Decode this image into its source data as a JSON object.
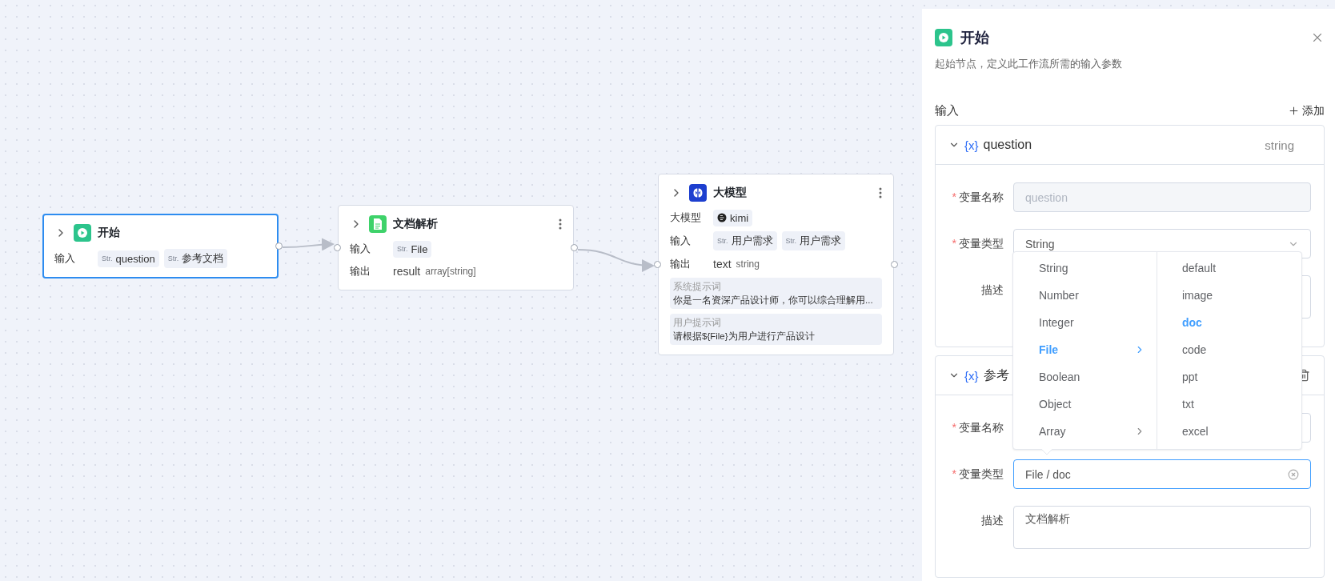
{
  "canvas": {
    "nodes": [
      {
        "kind": "start",
        "title": "开始",
        "selected": true,
        "rows": [
          {
            "kind": "chips",
            "label": "输入",
            "chips": [
              {
                "prefix": "Str.",
                "text": "question"
              },
              {
                "prefix": "Str.",
                "text": "参考文档"
              }
            ]
          }
        ]
      },
      {
        "kind": "doc",
        "title": "文档解析",
        "selected": false,
        "rows": [
          {
            "kind": "chips",
            "label": "输入",
            "chips": [
              {
                "prefix": "Str.",
                "text": "File"
              }
            ]
          },
          {
            "kind": "output",
            "label": "输出",
            "name": "result",
            "type": "array[string]"
          }
        ]
      },
      {
        "kind": "llm",
        "title": "大模型",
        "selected": false,
        "rows": [
          {
            "kind": "model",
            "label": "大模型",
            "model": "kimi"
          },
          {
            "kind": "chips",
            "label": "输入",
            "chips": [
              {
                "prefix": "Str.",
                "text": "用户需求"
              },
              {
                "prefix": "Str.",
                "text": "用户需求"
              }
            ]
          },
          {
            "kind": "output",
            "label": "输出",
            "name": "text",
            "type": "string"
          }
        ],
        "prompts": [
          {
            "label": "系统提示词",
            "text": "你是一名资深产品设计师，你可以综合理解用..."
          },
          {
            "label": "用户提示词",
            "text": "请根据${File}为用户进行产品设计"
          }
        ]
      }
    ]
  },
  "panel": {
    "title": "开始",
    "description": "起始节点，定义此工作流所需的输入参数",
    "section": "输入",
    "add_label": "添加",
    "variables": [
      {
        "icon": "{x}",
        "name": "question",
        "type": "string",
        "hovered": false,
        "fields": [
          {
            "kind": "input",
            "mark": "*",
            "label": "变量名称",
            "disabled": true,
            "value": "question"
          },
          {
            "kind": "select",
            "mark": "*",
            "label": "变量类型",
            "focused": false,
            "value": "String"
          },
          {
            "kind": "textarea",
            "label": "描述"
          }
        ]
      },
      {
        "icon": "{x}",
        "name": "参考",
        "hovered": true,
        "fields": [
          {
            "kind": "input",
            "mark": "*",
            "label": "变量名称"
          },
          {
            "kind": "select",
            "mark": "*",
            "label": "变量类型",
            "focused": true,
            "value": "File / doc"
          },
          {
            "kind": "textarea",
            "label": "描述",
            "value": "文档解析"
          }
        ]
      }
    ],
    "dropdown": {
      "columns": [
        [
          {
            "label": "String",
            "selected": false,
            "submenu": false
          },
          {
            "label": "Number",
            "selected": false,
            "submenu": false
          },
          {
            "label": "Integer",
            "selected": false,
            "submenu": false
          },
          {
            "label": "File",
            "selected": true,
            "submenu": true
          },
          {
            "label": "Boolean",
            "selected": false,
            "submenu": false
          },
          {
            "label": "Object",
            "selected": false,
            "submenu": false
          },
          {
            "label": "Array",
            "selected": false,
            "submenu": true
          }
        ],
        [
          {
            "label": "default",
            "selected": false,
            "submenu": false
          },
          {
            "label": "image",
            "selected": false,
            "submenu": false
          },
          {
            "label": "doc",
            "selected": true,
            "submenu": false
          },
          {
            "label": "code",
            "selected": false,
            "submenu": false
          },
          {
            "label": "ppt",
            "selected": false,
            "submenu": false
          },
          {
            "label": "txt",
            "selected": false,
            "submenu": false
          },
          {
            "label": "excel",
            "selected": false,
            "submenu": false
          }
        ]
      ]
    }
  }
}
